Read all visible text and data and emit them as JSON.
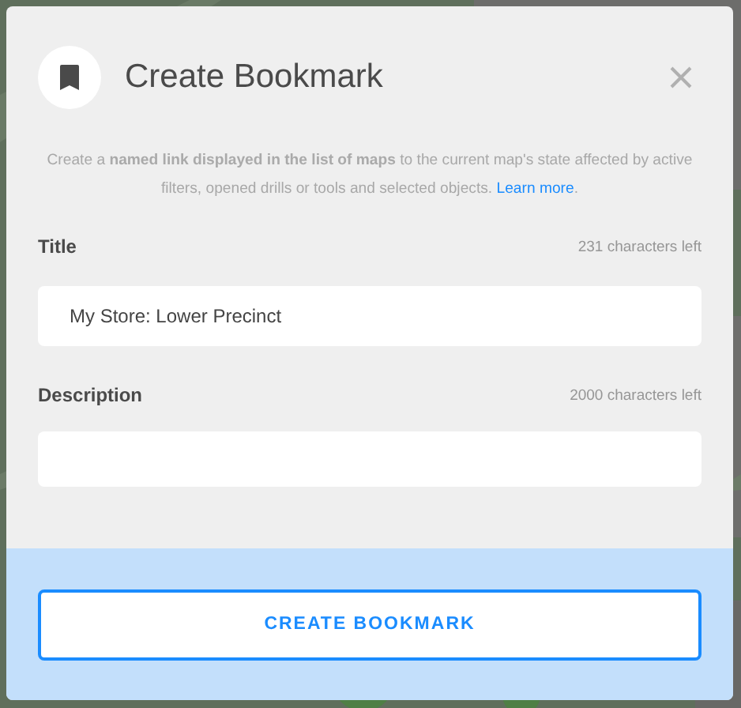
{
  "dialog": {
    "title": "Create Bookmark",
    "intro": {
      "text": "Create a **named link displayed in the list of maps** to the current map's state affected by active filters, opened drills or tools and selected objects.",
      "link": "Learn more",
      "after": "."
    },
    "fields": [
      {
        "label": "Title",
        "counter": "231 characters left",
        "value": "My Store: Lower Precinct"
      },
      {
        "label": "Description",
        "counter": "2000 characters left"
      }
    ],
    "button": "CREATE BOOKMARK"
  }
}
